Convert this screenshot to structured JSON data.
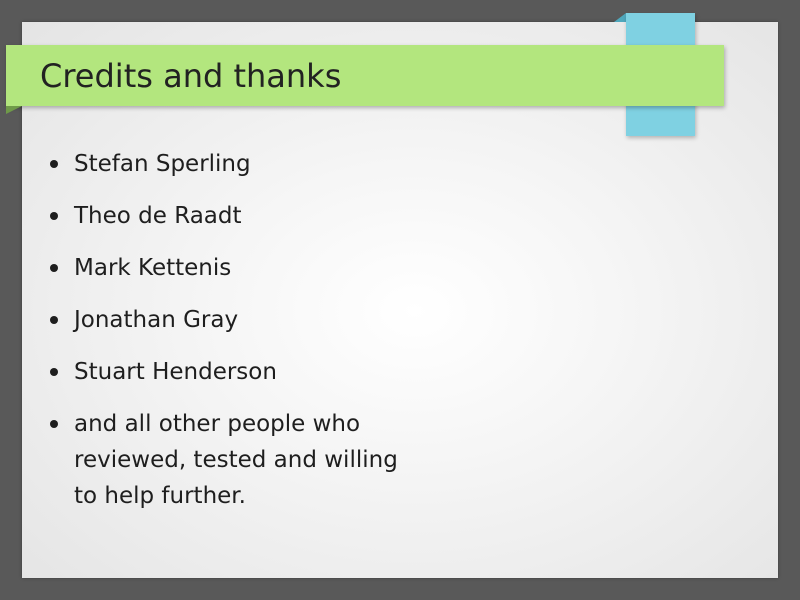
{
  "slide": {
    "title": "Credits and thanks",
    "bullets": [
      "Stefan Sperling",
      "Theo de Raadt",
      "Mark Kettenis",
      "Jonathan Gray",
      "Stuart Henderson",
      "and all other people who reviewed, tested and willing to help further."
    ]
  },
  "colors": {
    "background": "#595959",
    "title_band": "#b3e67e",
    "accent_block": "#7fd1e2",
    "text": "#1e1e1e"
  }
}
